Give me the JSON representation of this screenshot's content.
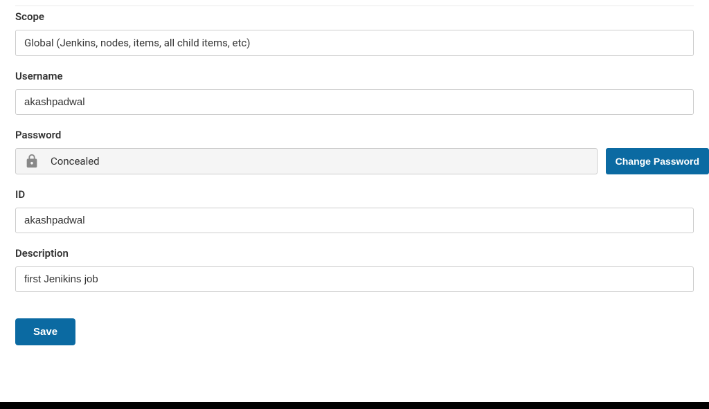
{
  "form": {
    "scope": {
      "label": "Scope",
      "value": "Global (Jenkins, nodes, items, all child items, etc)"
    },
    "username": {
      "label": "Username",
      "value": "akashpadwal"
    },
    "password": {
      "label": "Password",
      "status": "Concealed",
      "change_btn": "Change Password"
    },
    "id": {
      "label": "ID",
      "value": "akashpadwal"
    },
    "description": {
      "label": "Description",
      "value": "first Jenikins job"
    },
    "save_btn": "Save"
  }
}
